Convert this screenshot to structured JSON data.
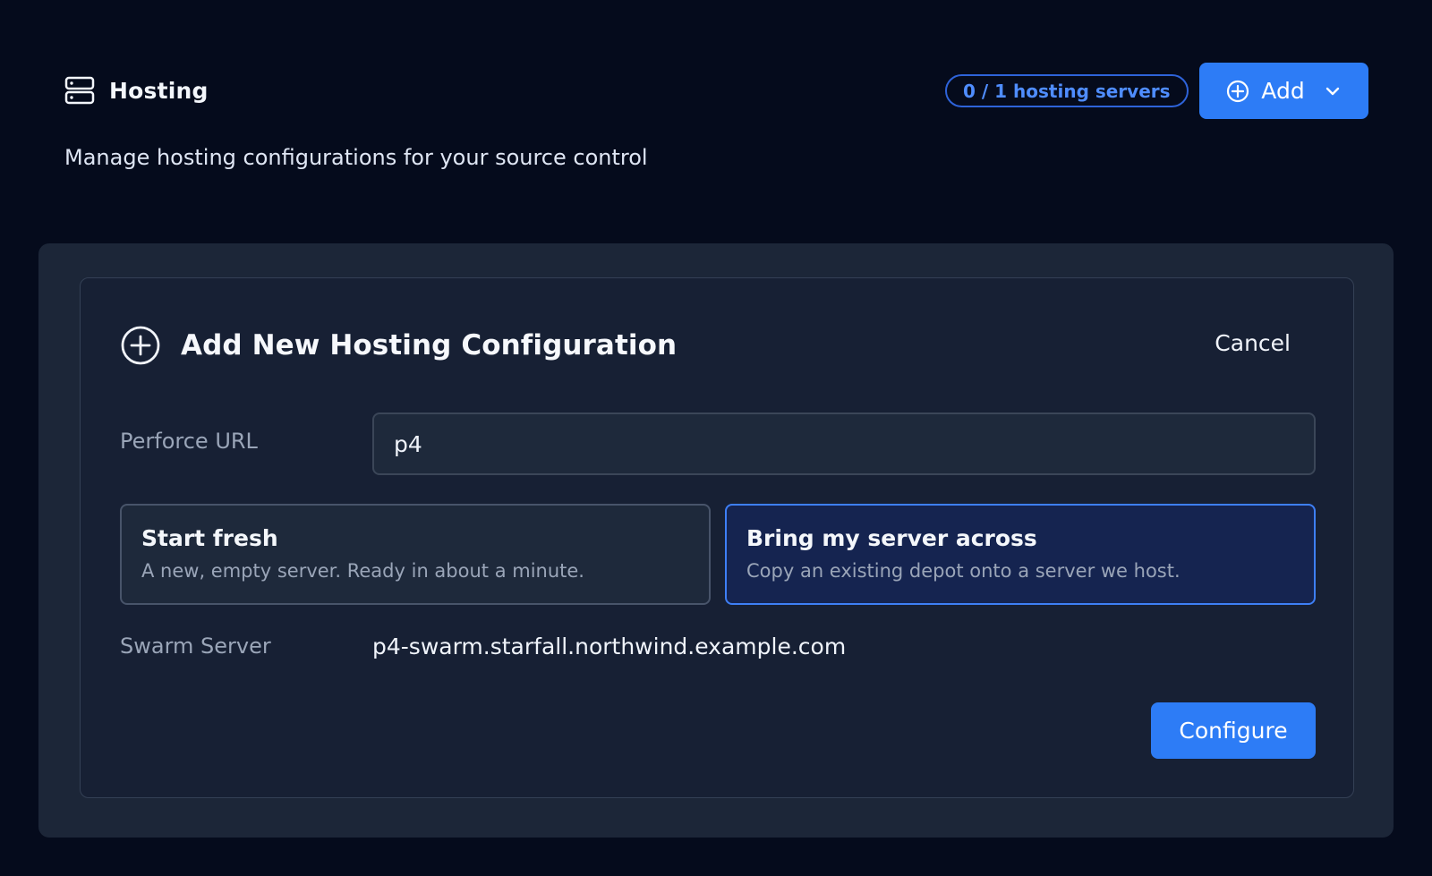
{
  "header": {
    "title": "Hosting",
    "title_icon": "server-icon",
    "server_count": "0 / 1 hosting servers",
    "add_button": {
      "label": "Add",
      "icon": "plus-circle-icon",
      "dropdown_icon": "chevron-down-icon"
    }
  },
  "subtitle": "Manage hosting configurations for your source control",
  "form": {
    "title": "Add New Hosting Configuration",
    "title_icon": "plus-circle-icon",
    "cancel_label": "Cancel",
    "perforce_url": {
      "label": "Perforce URL",
      "value": "p4"
    },
    "options": [
      {
        "title": "Start fresh",
        "description": "A new, empty server. Ready in about a minute.",
        "selected": false
      },
      {
        "title": "Bring my server across",
        "description": "Copy an existing depot onto a server we host.",
        "selected": true
      }
    ],
    "swarm_server": {
      "label": "Swarm Server",
      "value": "p4-swarm.starfall.northwind.example.com"
    },
    "configure_label": "Configure"
  },
  "colors": {
    "page_background": "#050b1c",
    "panel_background": "#1c2638",
    "accent": "#2d7cf6",
    "selected_option_border": "#3e7ff5"
  }
}
